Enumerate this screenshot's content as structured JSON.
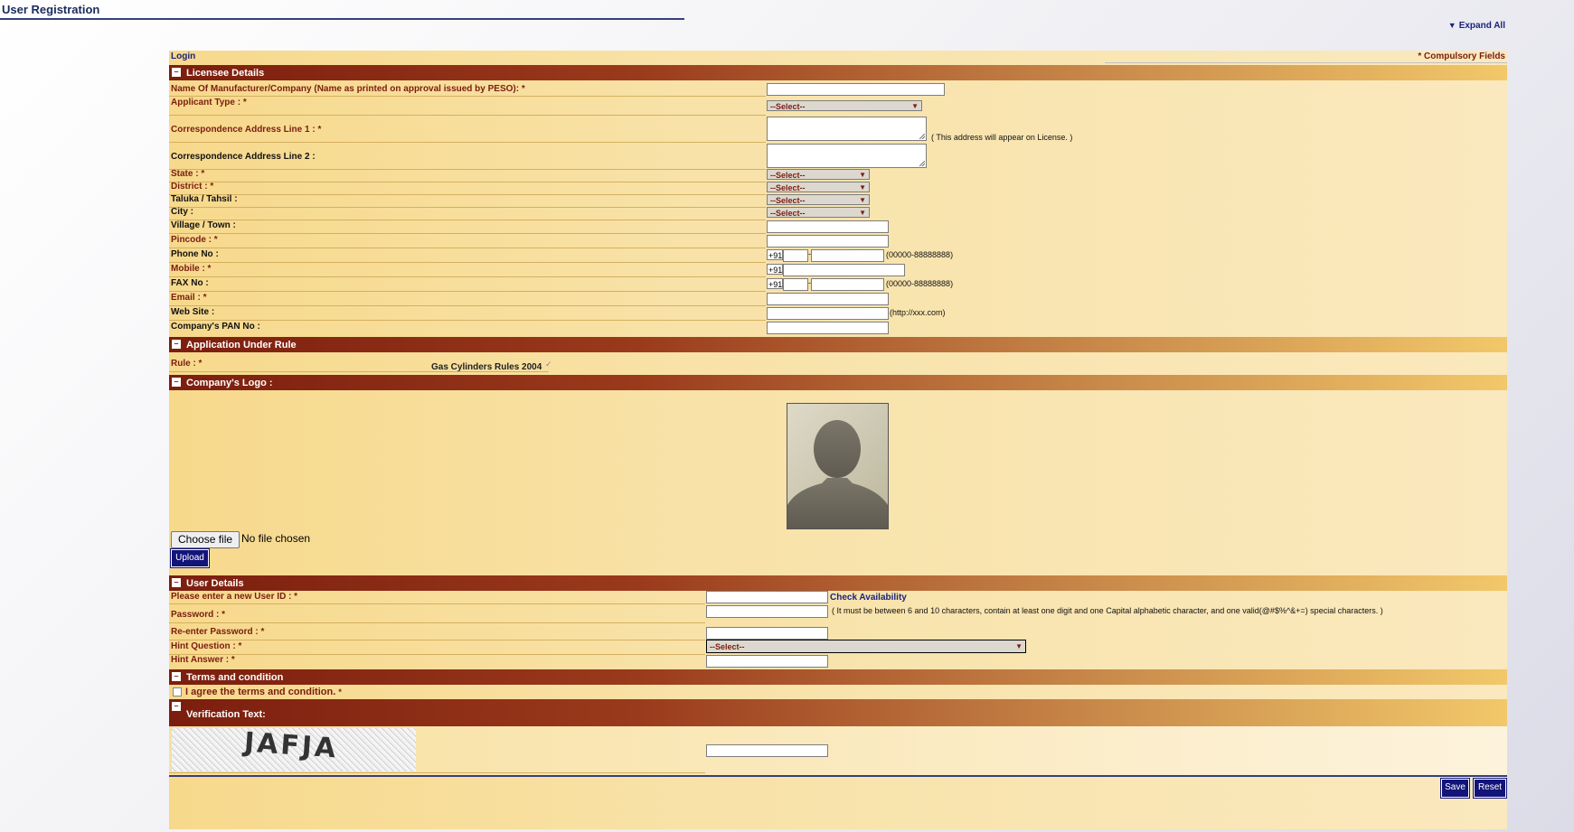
{
  "page": {
    "title": "User Registration",
    "expand_all": "Expand All"
  },
  "topbar": {
    "login": "Login",
    "compulsory": "* Compulsory Fields"
  },
  "sections": {
    "licensee": "Licensee Details",
    "rule": "Application Under Rule",
    "logo": "Company's Logo :",
    "user": "User Details",
    "terms": "Terms and condition",
    "verification": "Verification Text:"
  },
  "licensee": {
    "name_label": "Name Of Manufacturer/Company (Name as printed on approval issued by PESO): *",
    "applicant_type_label": "Applicant Type : *",
    "addr1_label": "Correspondence Address Line 1 : *",
    "addr2_label": "Correspondence Address Line 2 :",
    "addr_note": "( This address will appear on License. )",
    "state_label": "State : *",
    "district_label": "District : *",
    "taluka_label": "Taluka / Tahsil :",
    "city_label": "City :",
    "village_label": "Village / Town :",
    "pincode_label": "Pincode : *",
    "phone_label": "Phone No :",
    "mobile_label": "Mobile : *",
    "fax_label": "FAX No :",
    "email_label": "Email : *",
    "website_label": "Web Site :",
    "pan_label": "Company's PAN No :",
    "select_placeholder": "--Select--",
    "country_code": "+91",
    "phone_hint": "(00000-88888888)",
    "web_hint": "(http://xxx.com)"
  },
  "rule": {
    "label": "Rule : *",
    "value": "Gas Cylinders Rules 2004"
  },
  "logo": {
    "choose_file": "Choose file",
    "no_file": "No file chosen",
    "upload": "Upload"
  },
  "user": {
    "userid_label": "Please enter a new User ID : *",
    "check_availability": "Check Availability",
    "password_label": "Password : *",
    "password_note": "( It must be between 6 and 10 characters, contain at least one digit and one Capital alphabetic character, and one valid(@#$%^&+=) special characters. )",
    "reenter_label": "Re-enter Password : *",
    "hint_q_label": "Hint Question : *",
    "hint_q_value": "--Select--",
    "hint_a_label": "Hint Answer : *"
  },
  "terms": {
    "agree": "I agree the terms and condition.",
    "star": "*"
  },
  "verification": {
    "captcha_text": "JAFJA"
  },
  "actions": {
    "save": "Save",
    "reset": "Reset"
  }
}
